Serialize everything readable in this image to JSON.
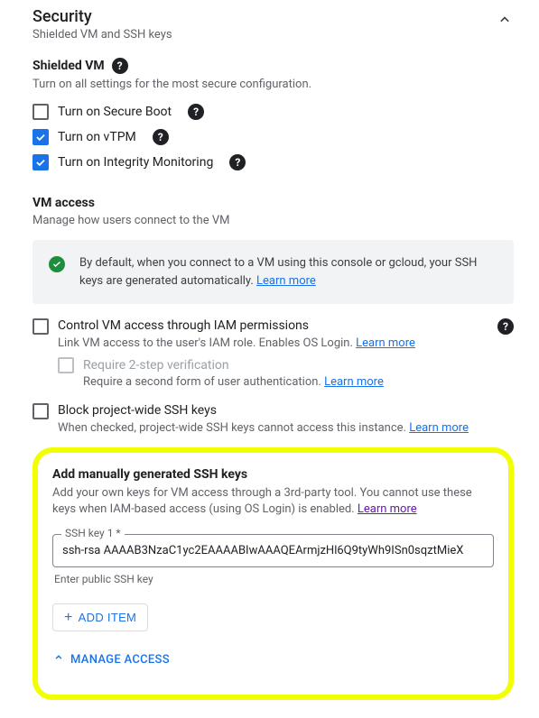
{
  "section": {
    "title": "Security",
    "subtitle": "Shielded VM and SSH keys"
  },
  "shielded": {
    "heading": "Shielded VM",
    "hint": "Turn on all settings for the most secure configuration.",
    "options": {
      "secure_boot": {
        "label": "Turn on Secure Boot",
        "checked": false
      },
      "vtpm": {
        "label": "Turn on vTPM",
        "checked": true
      },
      "integrity": {
        "label": "Turn on Integrity Monitoring",
        "checked": true
      }
    }
  },
  "vm_access": {
    "heading": "VM access",
    "hint": "Manage how users connect to the VM",
    "info_text": "By default, when you connect to a VM using this console or gcloud, your SSH keys are generated automatically. ",
    "info_link": "Learn more",
    "iam": {
      "label": "Control VM access through IAM permissions",
      "desc_prefix": "Link VM access to the user's IAM role. Enables OS Login. ",
      "desc_link": "Learn more",
      "two_step": {
        "label": "Require 2-step verification",
        "desc_prefix": "Require a second form of user authentication. ",
        "desc_link": "Learn more"
      }
    },
    "block_ssh": {
      "label": "Block project-wide SSH keys",
      "desc_prefix": "When checked, project-wide SSH keys cannot access this instance. ",
      "desc_link": "Learn more"
    }
  },
  "ssh": {
    "heading": "Add manually generated SSH keys",
    "desc_prefix": "Add your own keys for VM access through a 3rd-party tool. You cannot use these keys when IAM-based access (using OS Login) is enabled. ",
    "desc_link": "Learn more",
    "field_label": "SSH key 1 *",
    "value": "ssh-rsa AAAAB3NzaC1yc2EAAAABIwAAAQEArmjzHl6Q9tyWh9ISn0sqztMieX",
    "field_hint": "Enter public SSH key",
    "add_item": "ADD ITEM",
    "manage": "MANAGE ACCESS"
  }
}
